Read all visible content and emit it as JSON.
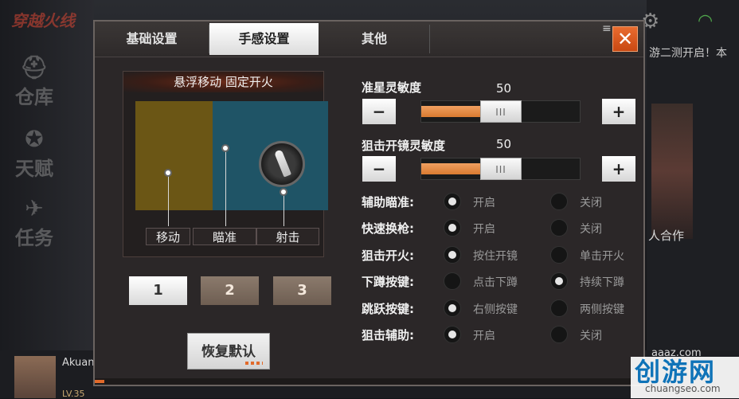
{
  "background": {
    "brand": "穿越火线",
    "nav": [
      {
        "label": "仓库"
      },
      {
        "label": "天赋"
      },
      {
        "label": "任务"
      }
    ],
    "ticker": "游二测开启！本",
    "coop_label": "人合作",
    "user": {
      "name": "Akuan",
      "level": "LV.35"
    },
    "site_label": "aaaz.com"
  },
  "watermark": {
    "cn": "创游网",
    "url": "chuangseo.com"
  },
  "dialog": {
    "tabs": [
      {
        "label": "基础设置",
        "active": false
      },
      {
        "label": "手感设置",
        "active": true
      },
      {
        "label": "其他",
        "active": false
      }
    ],
    "close_label": "✕",
    "preview": {
      "title": "悬浮移动 固定开火",
      "zones": [
        {
          "label": "移动"
        },
        {
          "label": "瞄准"
        },
        {
          "label": "射击"
        }
      ],
      "colors": {
        "move": "#6b5615",
        "aim": "#1f5466"
      }
    },
    "presets": [
      {
        "label": "1",
        "selected": true
      },
      {
        "label": "2",
        "selected": false
      },
      {
        "label": "3",
        "selected": false
      }
    ],
    "reset_label": "恢复默认",
    "sliders": [
      {
        "label": "准星灵敏度",
        "value": 50,
        "min": 0,
        "max": 100,
        "minus_label": "−",
        "plus_label": "+",
        "thumb_label": "III"
      },
      {
        "label": "狙击开镜灵敏度",
        "value": 50,
        "min": 0,
        "max": 100,
        "minus_label": "−",
        "plus_label": "+",
        "thumb_label": "III"
      }
    ],
    "options": [
      {
        "label": "辅助瞄准:",
        "choices": [
          {
            "text": "开启",
            "selected": true
          },
          {
            "text": "关闭",
            "selected": false
          }
        ]
      },
      {
        "label": "快速换枪:",
        "choices": [
          {
            "text": "开启",
            "selected": true
          },
          {
            "text": "关闭",
            "selected": false
          }
        ]
      },
      {
        "label": "狙击开火:",
        "choices": [
          {
            "text": "按住开镜",
            "selected": true
          },
          {
            "text": "单击开火",
            "selected": false
          }
        ]
      },
      {
        "label": "下蹲按键:",
        "choices": [
          {
            "text": "点击下蹲",
            "selected": false
          },
          {
            "text": "持续下蹲",
            "selected": true
          }
        ]
      },
      {
        "label": "跳跃按键:",
        "choices": [
          {
            "text": "右侧按键",
            "selected": true
          },
          {
            "text": "两侧按键",
            "selected": false
          }
        ]
      },
      {
        "label": "狙击辅助:",
        "choices": [
          {
            "text": "开启",
            "selected": true
          },
          {
            "text": "关闭",
            "selected": false
          }
        ]
      }
    ],
    "accent": "#e26a2a"
  }
}
